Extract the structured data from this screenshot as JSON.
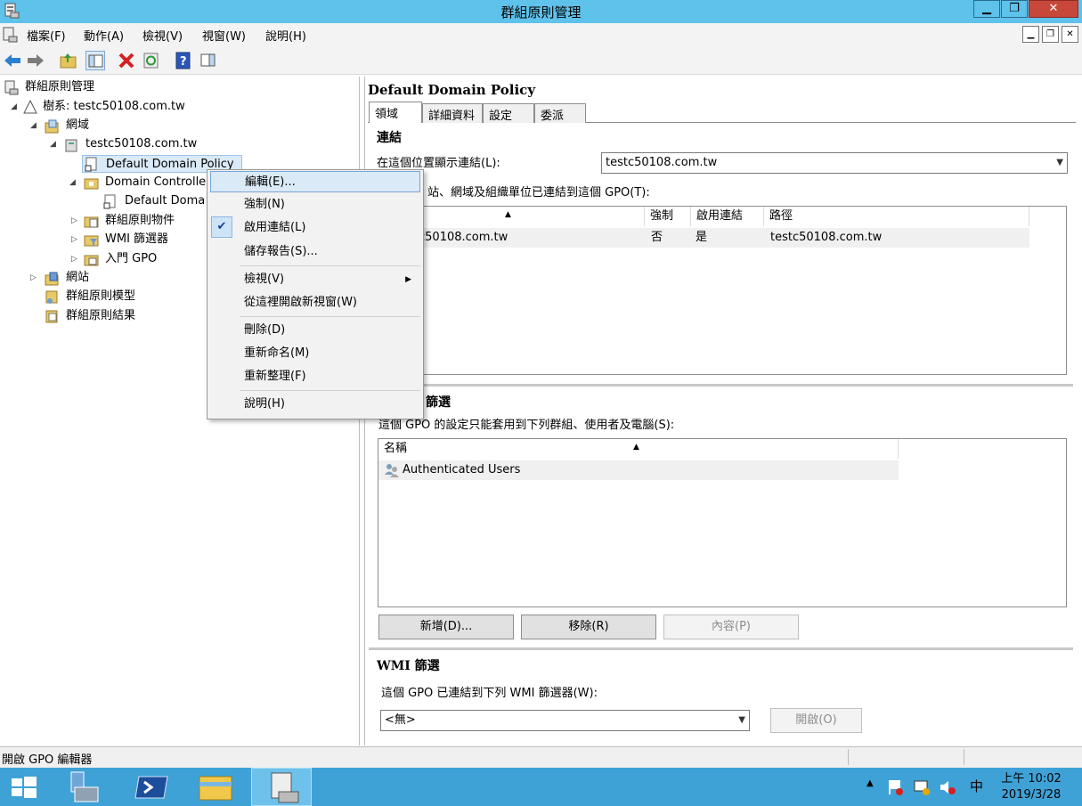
{
  "window": {
    "title": "群組原則管理"
  },
  "menubar": {
    "items": [
      "檔案(F)",
      "動作(A)",
      "檢視(V)",
      "視窗(W)",
      "說明(H)"
    ]
  },
  "tree": {
    "root": "群組原則管理",
    "forest": "樹系: testc50108.com.tw",
    "domains": "網域",
    "domain": "testc50108.com.tw",
    "default_policy": "Default Domain Policy",
    "dc": "Domain Controlle",
    "dc_policy": "Default Doma",
    "gpo_objects": "群組原則物件",
    "wmi_filters": "WMI 篩選器",
    "starter_gpo": "入門 GPO",
    "sites": "網站",
    "modeling": "群組原則模型",
    "results": "群組原則結果"
  },
  "context_menu": {
    "edit": "編輯(E)...",
    "enforce": "強制(N)",
    "link_enabled": "啟用連結(L)",
    "save_report": "儲存報告(S)...",
    "view": "檢視(V)",
    "new_window": "從這裡開啟新視窗(W)",
    "delete": "刪除(D)",
    "rename": "重新命名(M)",
    "refresh": "重新整理(F)",
    "help": "說明(H)"
  },
  "details": {
    "title": "Default Domain Policy",
    "tabs": [
      "領域",
      "詳細資料",
      "設定",
      "委派"
    ],
    "links": {
      "heading": "連結",
      "location_label": "在這個位置顯示連結(L):",
      "location_value": "testc50108.com.tw",
      "desc": "站、網域及組織單位已連結到這個 GPO(T):",
      "columns": [
        "強制",
        "啟用連結",
        "路徑"
      ],
      "row": {
        "location": "c50108.com.tw",
        "enforced": "否",
        "enabled": "是",
        "path": "testc50108.com.tw"
      }
    },
    "security": {
      "heading": "篩選",
      "desc": "這個 GPO 的設定只能套用到下列群組、使用者及電腦(S):",
      "column": "名稱",
      "rows": [
        "Authenticated Users"
      ],
      "add": "新增(D)...",
      "remove": "移除(R)",
      "properties": "內容(P)"
    },
    "wmi": {
      "heading": "WMI 篩選",
      "desc": "這個 GPO 已連結到下列 WMI 篩選器(W):",
      "value": "<無>",
      "open": "開啟(O)"
    }
  },
  "statusbar": {
    "text": "開啟 GPO 編輯器"
  },
  "taskbar": {
    "time": "上午 10:02",
    "date": "2019/3/28",
    "ime": "中"
  },
  "colors": {
    "titlebar": "#5ec2ea",
    "taskbar": "#3fa2d6",
    "menu_highlight": "#dbeaf7"
  }
}
